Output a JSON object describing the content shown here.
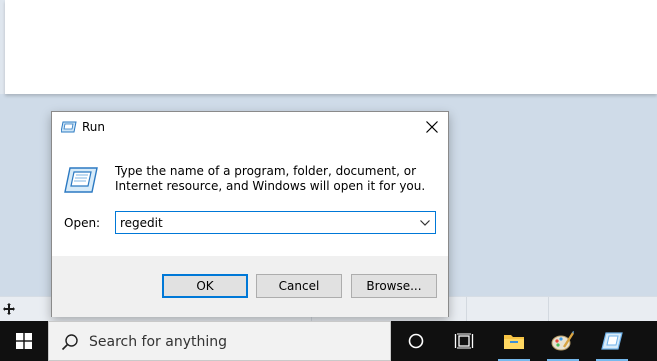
{
  "dialog": {
    "title": "Run",
    "description": "Type the name of a program, folder, document, or Internet resource, and Windows will open it for you.",
    "open_label": "Open:",
    "open_value": "regedit",
    "buttons": {
      "ok": "OK",
      "cancel": "Cancel",
      "browse": "Browse..."
    }
  },
  "taskbar": {
    "search_placeholder": "Search for anything",
    "icons": [
      "start-icon",
      "cortana-icon",
      "task-view-icon",
      "file-explorer-icon",
      "paint-icon",
      "run-icon"
    ],
    "accent": "#76b9ed"
  },
  "colors": {
    "desktop": "#cfdbe8",
    "taskbar": "#101010",
    "focus_border": "#0078d7"
  }
}
